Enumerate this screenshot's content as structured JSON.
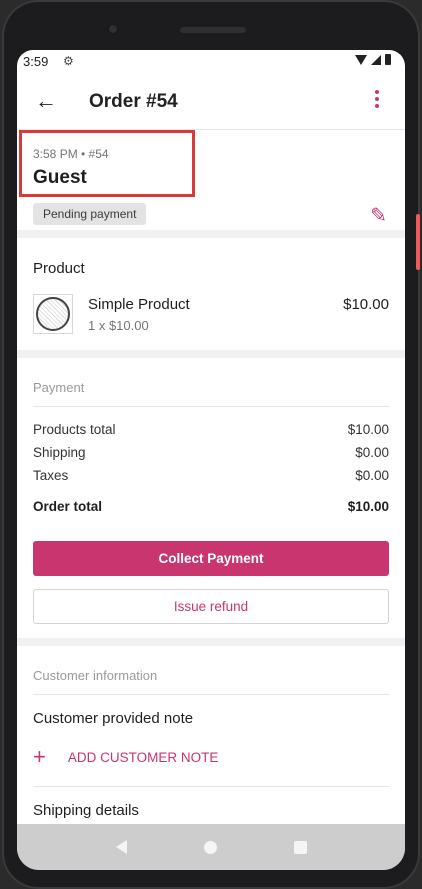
{
  "status_bar": {
    "time": "3:59",
    "gear_icon": "gear-icon"
  },
  "toolbar": {
    "title": "Order #54",
    "back_icon": "arrow-left-icon",
    "more_icon": "more-vert-icon"
  },
  "order_header": {
    "date_line": "3:58 PM • #54",
    "customer_name": "Guest",
    "status_badge": "Pending payment",
    "edit_icon": "pencil-icon"
  },
  "product": {
    "section_title": "Product",
    "items": [
      {
        "name": "Simple Product",
        "quantity_line": "1 x $10.00",
        "price": "$10.00"
      }
    ]
  },
  "payment": {
    "section_title": "Payment",
    "rows": [
      {
        "label": "Products total",
        "value": "$10.00"
      },
      {
        "label": "Shipping",
        "value": "$0.00"
      },
      {
        "label": "Taxes",
        "value": "$0.00"
      }
    ],
    "total": {
      "label": "Order total",
      "value": "$10.00"
    },
    "collect_button": "Collect Payment",
    "refund_button": "Issue refund"
  },
  "customer": {
    "section_title": "Customer information",
    "note_title": "Customer provided note",
    "add_note_label": "ADD CUSTOMER NOTE",
    "shipping_title": "Shipping details"
  },
  "colors": {
    "accent": "#c9356e",
    "highlight": "#d83a3a"
  }
}
